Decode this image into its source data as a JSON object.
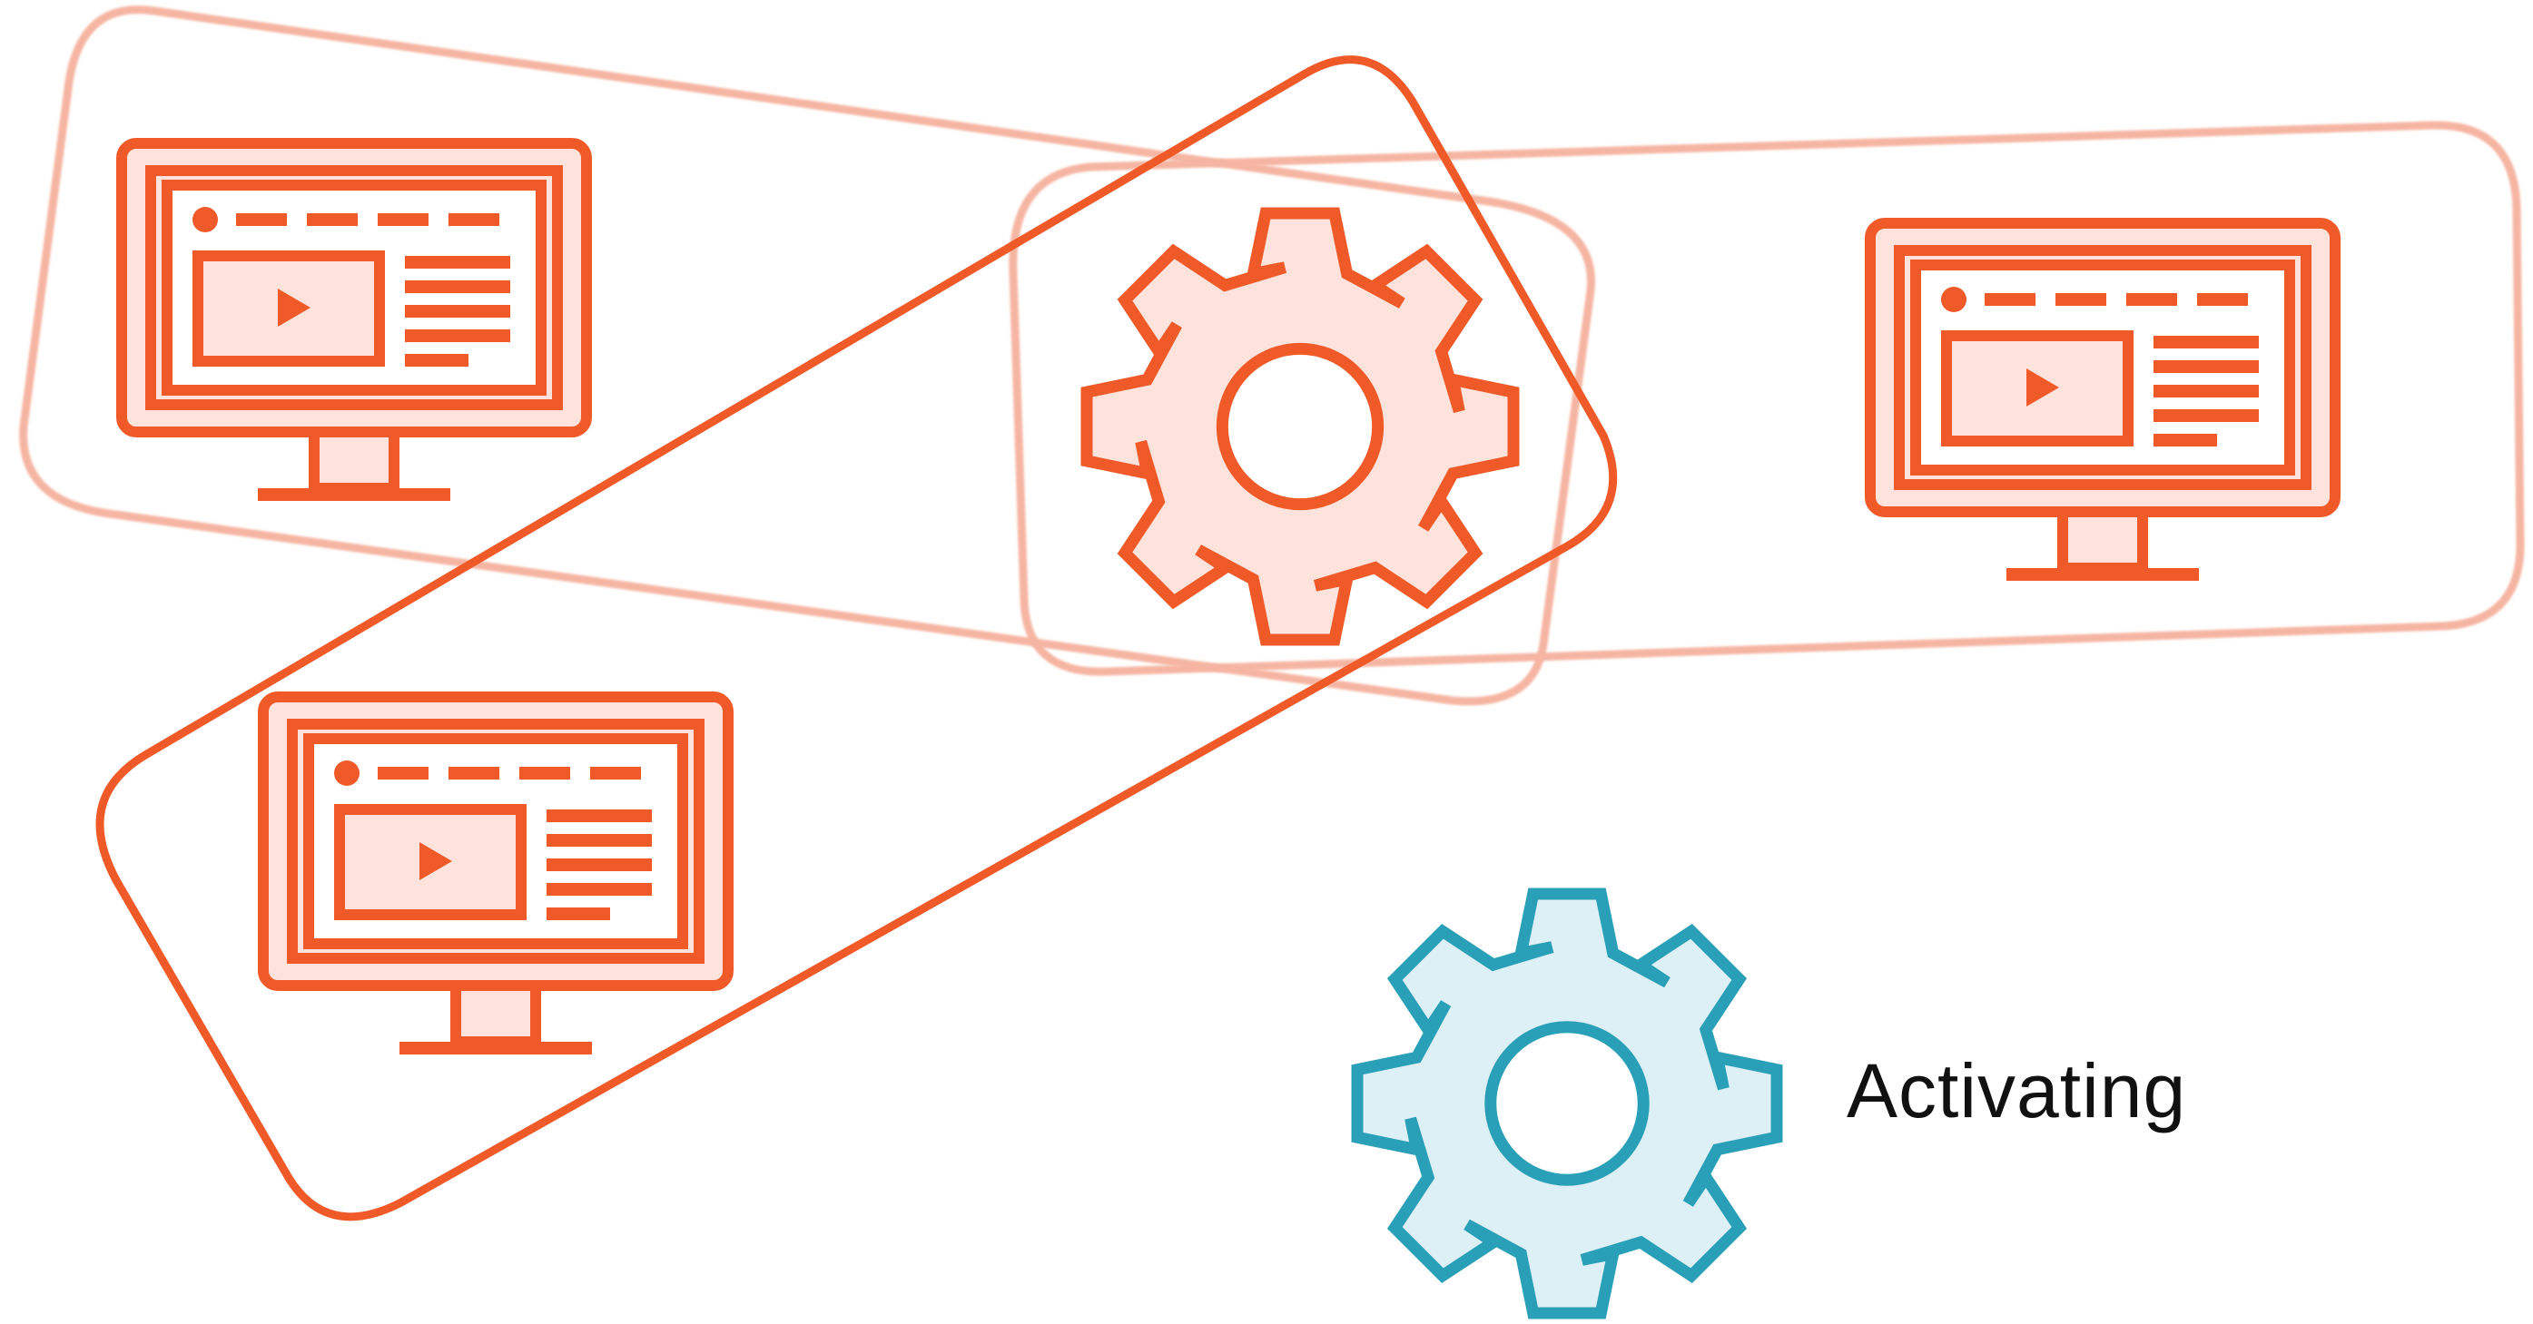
{
  "diagram": {
    "status_text": "Activating",
    "colors": {
      "accent": "#F05A28",
      "accent_fill": "#FDE3DC",
      "accent_faded": "#F6B5A2",
      "active": "#2AA0B8",
      "active_fill": "#DDF0F6",
      "text": "#111111",
      "background": "#FFFFFF"
    },
    "icons": {
      "monitor": "monitor-icon",
      "play": "play-icon",
      "gear": "gear-icon"
    }
  }
}
